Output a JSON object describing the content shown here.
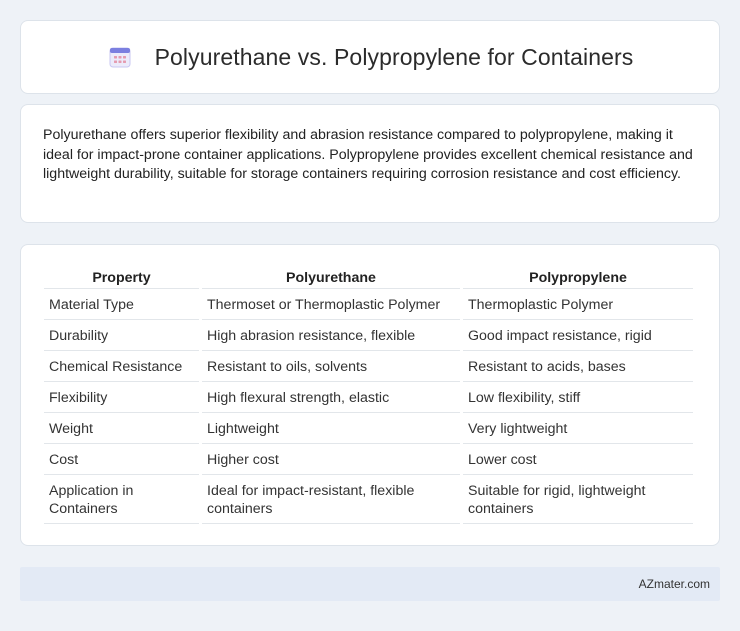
{
  "header": {
    "title": "Polyurethane vs. Polypropylene for Containers",
    "icon": "calendar-icon"
  },
  "summary": "Polyurethane offers superior flexibility and abrasion resistance compared to polypropylene, making it ideal for impact-prone container applications. Polypropylene provides excellent chemical resistance and lightweight durability, suitable for storage containers requiring corrosion resistance and cost efficiency.",
  "table": {
    "headers": [
      "Property",
      "Polyurethane",
      "Polypropylene"
    ],
    "rows": [
      [
        "Material Type",
        "Thermoset or Thermoplastic Polymer",
        "Thermoplastic Polymer"
      ],
      [
        "Durability",
        "High abrasion resistance, flexible",
        "Good impact resistance, rigid"
      ],
      [
        "Chemical Resistance",
        "Resistant to oils, solvents",
        "Resistant to acids, bases"
      ],
      [
        "Flexibility",
        "High flexural strength, elastic",
        "Low flexibility, stiff"
      ],
      [
        "Weight",
        "Lightweight",
        "Very lightweight"
      ],
      [
        "Cost",
        "Higher cost",
        "Lower cost"
      ],
      [
        "Application in Containers",
        "Ideal for impact-resistant, flexible containers",
        "Suitable for rigid, lightweight containers"
      ]
    ]
  },
  "footer": {
    "brand": "AZmater.com"
  },
  "colors": {
    "background": "#eef2f7",
    "card": "#ffffff",
    "footer": "#e3eaf5",
    "icon_accent": "#7b7fe0"
  }
}
